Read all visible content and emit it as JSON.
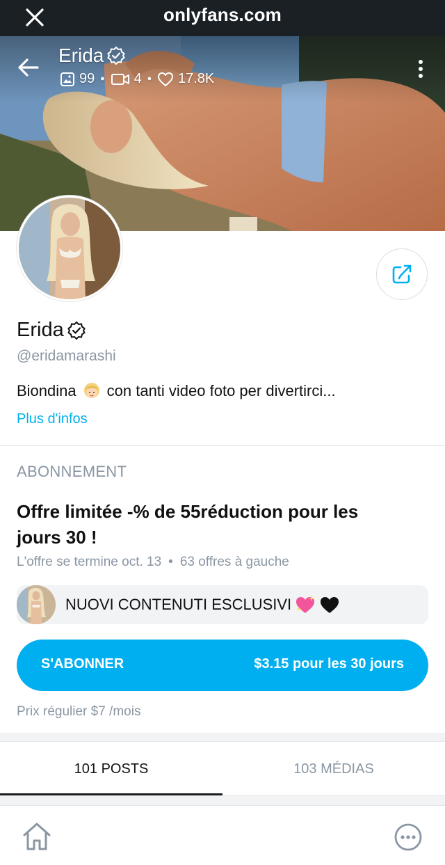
{
  "browser": {
    "url": "onlyfans.com"
  },
  "cover": {
    "name": "Erida",
    "stats": {
      "photos": "99",
      "videos": "4",
      "likes": "17.8K"
    }
  },
  "profile": {
    "name": "Erida",
    "handle": "@eridamarashi",
    "bio_before_emoji": "Biondina",
    "bio_after_emoji": "con tanti video foto per divertirci...",
    "more_info": "Plus d'infos"
  },
  "subscription": {
    "section_label": "ABONNEMENT",
    "offer_title": "Offre limitée -% de 55réduction pour les jours 30 !",
    "offer_ends": "L'offre se termine oct. 13",
    "offers_left": "63 offres à gauche",
    "promo_message": "NUOVI CONTENUTI ESCLUSIVI",
    "subscribe_label": "S'ABONNER",
    "subscribe_price": "$3.15 pour les 30 jours",
    "regular_price": "Prix régulier $7 /mois"
  },
  "tabs": [
    {
      "label": "101 POSTS",
      "active": true
    },
    {
      "label": "103 MÉDIAS",
      "active": false
    }
  ],
  "colors": {
    "accent": "#00aff0",
    "browser_bar": "#1b2024",
    "muted_text": "#8a96a3"
  },
  "icons": {
    "close": "close-icon",
    "back": "back-arrow-icon",
    "photos": "image-icon",
    "videos": "video-camera-icon",
    "likes": "heart-icon",
    "menu": "more-vertical-icon",
    "verified": "verified-badge-icon",
    "share": "share-icon",
    "home": "home-icon",
    "more": "more-horizontal-icon"
  }
}
